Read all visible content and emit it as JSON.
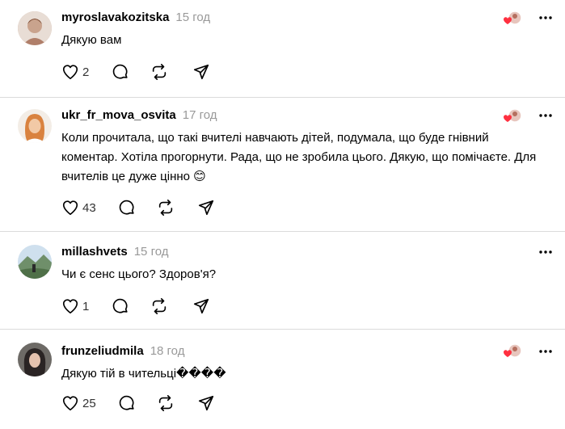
{
  "comments": [
    {
      "username": "myroslavakozitska",
      "time": "15 год",
      "text": "Дякую вам",
      "likes": "2",
      "avatar_color": "#c9a38d"
    },
    {
      "username": "ukr_fr_mova_osvita",
      "time": "17 год",
      "text": "Коли прочитала, що такі вчителі навчають дітей, подумала, що буде гнівний коментар. Хотіла прогорнути. Рада, що не зробила цього. Дякую, що помічаєте. Для вчителів це дуже цінно 😊",
      "likes": "43",
      "avatar_color": "#d89a6a"
    },
    {
      "username": "millashvets",
      "time": "15 год",
      "text": "Чи є сенс цього? Здоров'я?",
      "likes": "1",
      "avatar_color": "#6f8f6a"
    },
    {
      "username": "frunzeliudmila",
      "time": "18 год",
      "text": "Дякую тій в чительці����",
      "likes": "25",
      "avatar_color": "#3d3a3a"
    }
  ],
  "colors": {
    "heart_red": "#ff3040",
    "divider": "#dbdbdb",
    "muted": "#999999"
  },
  "icons": [
    "heart-icon",
    "comment-icon",
    "repost-icon",
    "share-icon",
    "more-icon",
    "liked-by-author-icon"
  ]
}
